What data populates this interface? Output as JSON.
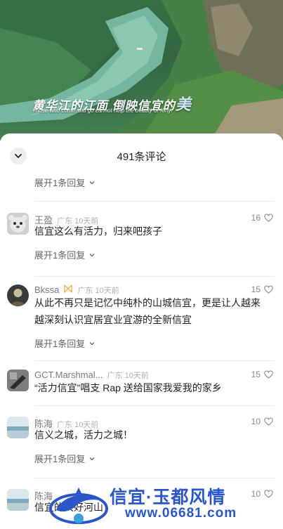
{
  "video": {
    "overlay_title": "黄华江的江面 倒映信宜的",
    "overlay_title_accent": "美",
    "overlay_subtitle": "Those who come and go cannot help the beauty of Xinyi"
  },
  "comments_panel": {
    "title": "491条评论",
    "collapse_icon": "chevron-down-icon",
    "expand_first_label": "展开1条回复"
  },
  "comments": [
    {
      "username": "王盈",
      "badge": "",
      "location": "广东 10天前",
      "likes": "16",
      "text": "信宜这么有活力，归来吧孩子",
      "expand_label": "展开1条回复"
    },
    {
      "username": "Bkssa",
      "badge": "🎀",
      "location": "广东 10天前",
      "likes": "15",
      "text": "从此不再只是记忆中纯朴的山城信宜，更是让人越来越深刻认识宜居宜业宜游的全新信宜",
      "expand_label": "展开1条回复"
    },
    {
      "username": "GCT.Marshmal...",
      "badge": "",
      "location": "广东 10天前",
      "likes": "15",
      "text": "“活力信宜”唱支 Rap 送给国家我爱我的家乡",
      "expand_label": ""
    },
    {
      "username": "陈海",
      "badge": "",
      "location": "广东 10天前",
      "likes": "10",
      "text": "信义之城，活力之城！",
      "expand_label": "展开1条回复"
    },
    {
      "username": "陈海",
      "badge": "",
      "location": "",
      "likes": "10",
      "text": "信宜的大好河山",
      "expand_label": ""
    }
  ],
  "watermark": {
    "title": "信宜·玉都风情",
    "url": "www.06681.com"
  },
  "colors": {
    "accent_badge": "#e3b44a",
    "watermark_blue": "#2a56c9"
  }
}
